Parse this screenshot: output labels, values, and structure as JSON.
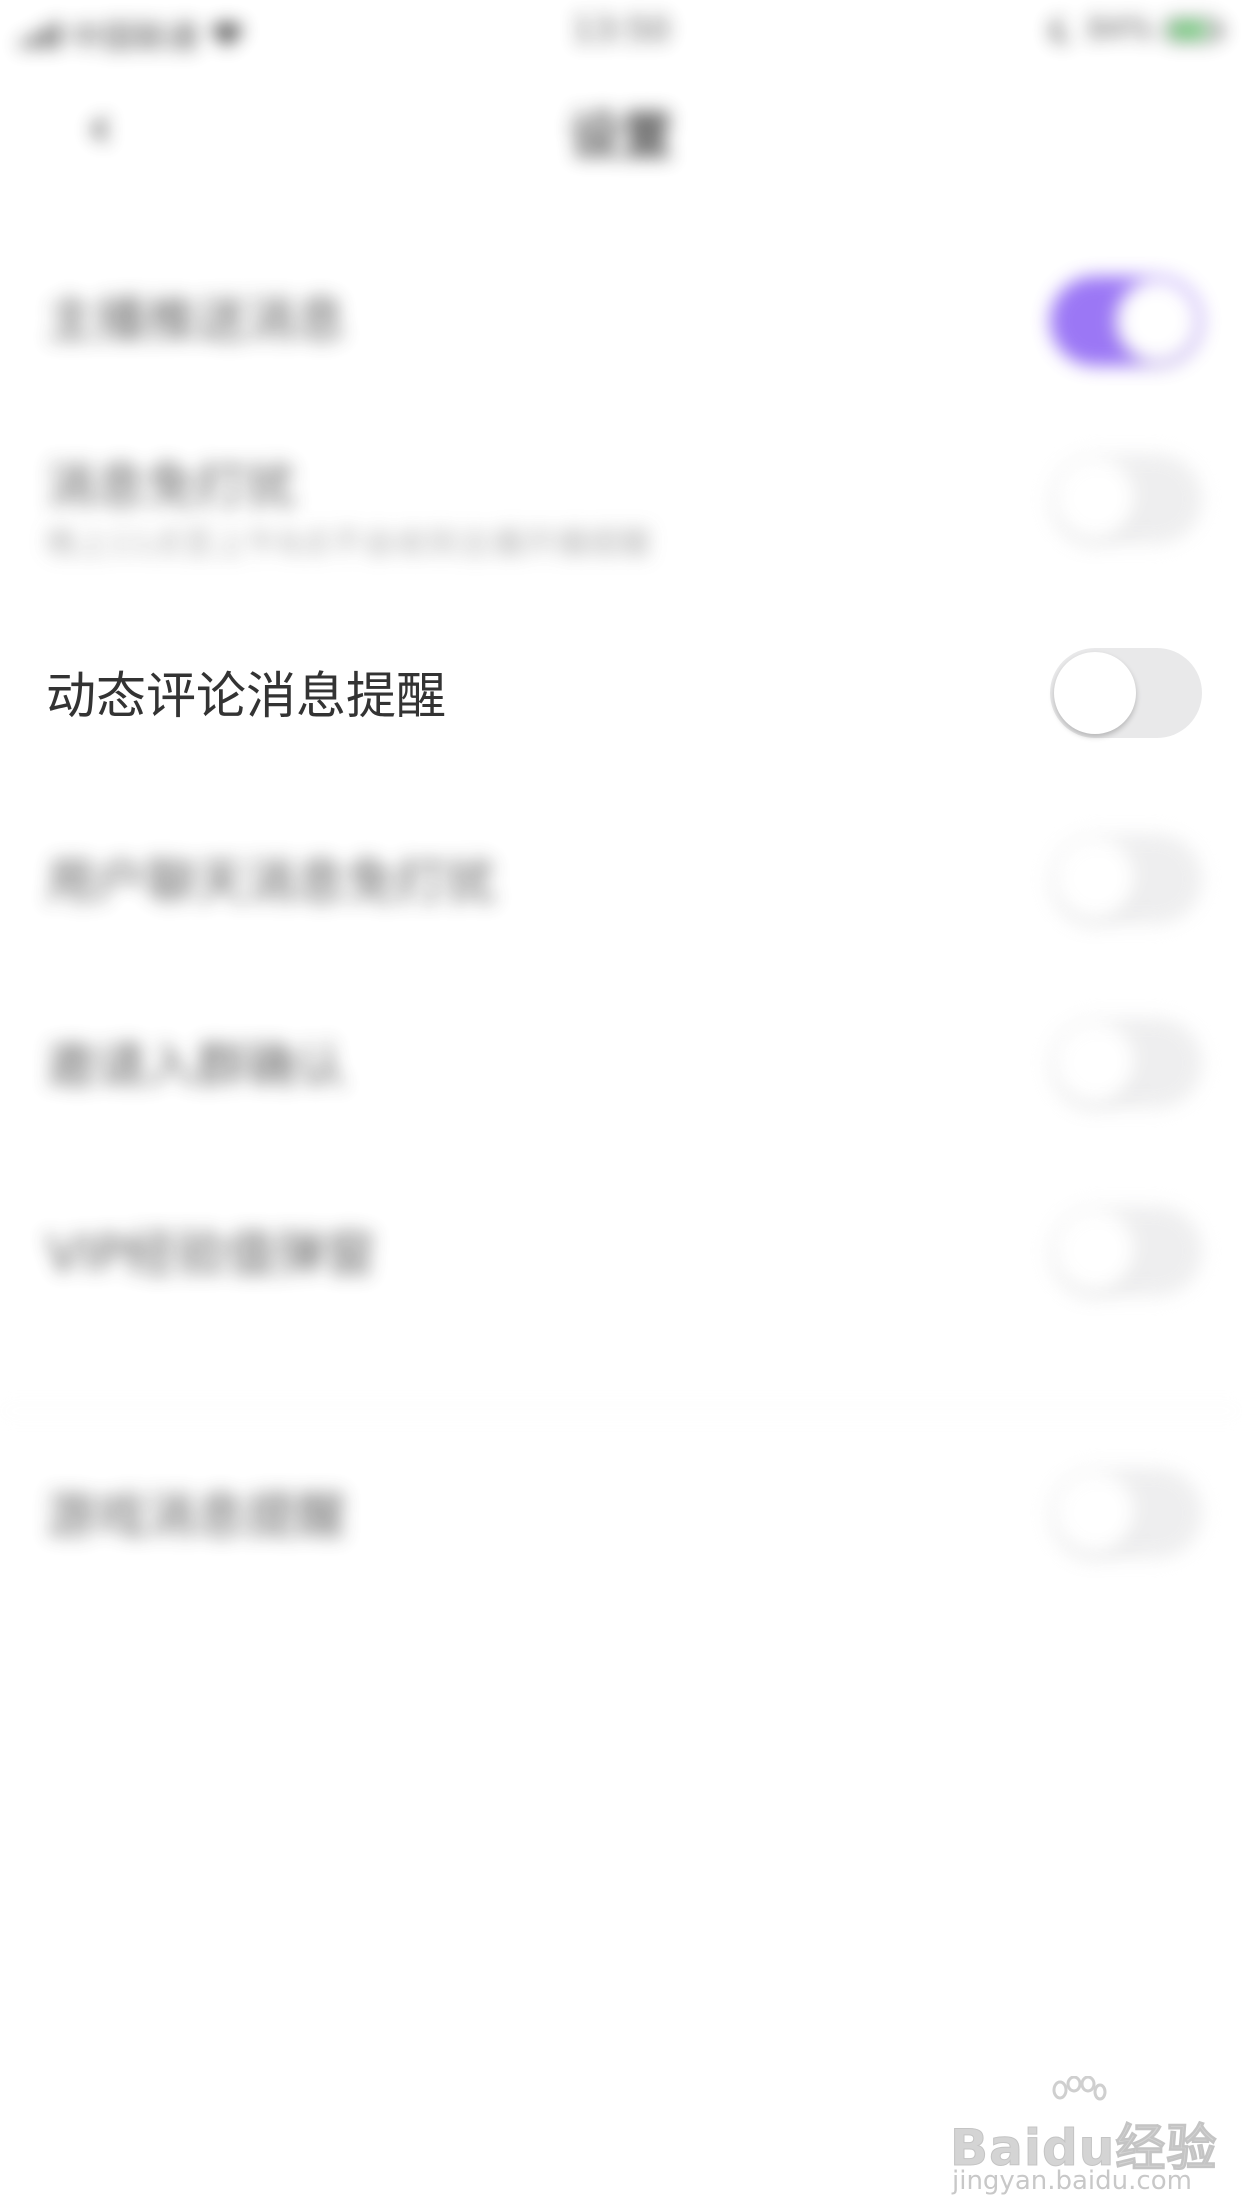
{
  "status_bar": {
    "carrier": "中国联通",
    "time": "13:50",
    "battery_percent": "84%",
    "battery_level": 0.84,
    "icons": [
      "signal-icon",
      "wifi-icon",
      "moon-icon",
      "battery-icon"
    ]
  },
  "nav": {
    "back_icon": "chevron-left-icon",
    "back_glyph": "‹",
    "title": "设置"
  },
  "settings": [
    {
      "label": "主播推送消息",
      "subtitle": "",
      "on": true
    },
    {
      "label": "消息免打扰",
      "subtitle": "晚上11点至上午8点不会收到主播开播提醒",
      "on": false
    },
    {
      "label": "动态评论消息提醒",
      "subtitle": "",
      "on": false
    },
    {
      "label": "用户聊天消息免打扰",
      "subtitle": "",
      "on": false
    },
    {
      "label": "邀请入群确认",
      "subtitle": "",
      "on": false
    },
    {
      "label": "VIP经验值弹窗",
      "subtitle": "",
      "on": false
    },
    {
      "label": "游戏消息提醒",
      "subtitle": "",
      "on": false
    }
  ],
  "colors": {
    "toggle_on": "#7a4af2",
    "toggle_off": "#e9e9ea",
    "battery_fill": "#3cc64b"
  },
  "watermark": {
    "logo": "Baidu经验",
    "url": "jingyan.baidu.com"
  }
}
